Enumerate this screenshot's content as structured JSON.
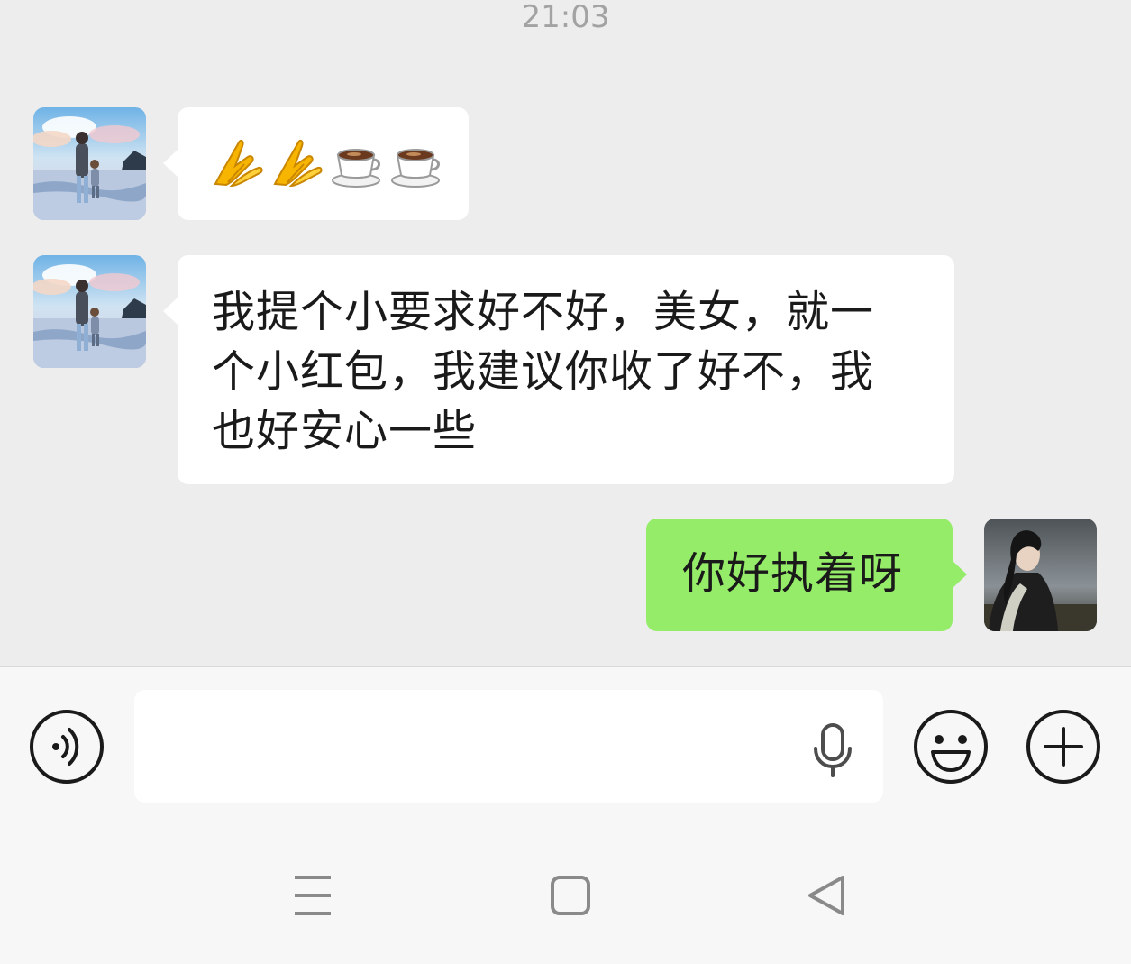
{
  "timestamp": "21:03",
  "messages": [
    {
      "id": "m1",
      "direction": "incoming",
      "type": "emoji",
      "emoji": [
        "folded-hands",
        "folded-hands",
        "coffee",
        "coffee"
      ]
    },
    {
      "id": "m2",
      "direction": "incoming",
      "type": "text",
      "lines": [
        "我提个小要求好不好，美女，就一",
        "个小红包，我建议你收了好不，我",
        "也好安心一些"
      ]
    },
    {
      "id": "m3",
      "direction": "outgoing",
      "type": "text",
      "text": "你好执着呀"
    }
  ],
  "input_bar": {
    "voice_icon": "voice-mode-icon",
    "text_value": "",
    "mic_icon": "microphone-icon",
    "emoji_icon": "smiley-icon",
    "plus_icon": "plus-icon"
  },
  "nav_bar": {
    "menu_icon": "menu-icon",
    "home_icon": "home-square-icon",
    "back_icon": "back-triangle-icon"
  },
  "colors": {
    "chat_bg": "#ededed",
    "incoming_bubble": "#ffffff",
    "outgoing_bubble": "#95ec69",
    "bar_bg": "#f7f7f7",
    "timestamp": "#a3a3a3"
  }
}
